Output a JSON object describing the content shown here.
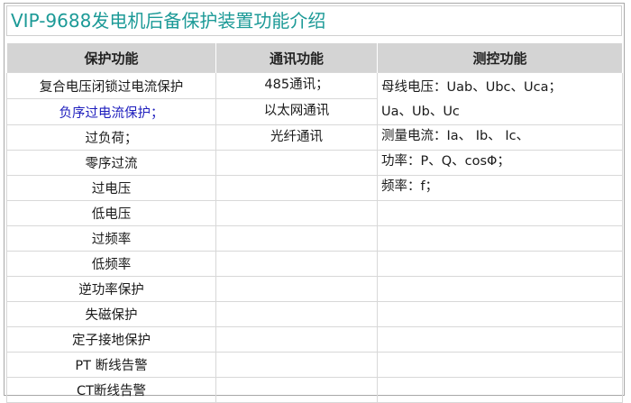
{
  "title": "VIP-9688发电机后备保护装置功能介绍",
  "headers": {
    "protection": "保护功能",
    "communication": "通讯功能",
    "measurement": "测控功能"
  },
  "protection_items": [
    "复合电压闭锁过电流保护",
    "负序过电流保护；",
    "过负荷；",
    "零序过流",
    "过电压",
    "低电压",
    "过频率",
    "低频率",
    "逆功率保护",
    "失磁保护",
    "定子接地保护",
    "PT 断线告警",
    "CT断线告警"
  ],
  "communication_items": [
    "485通讯；",
    "以太网通讯",
    "光纤通讯"
  ],
  "measurement": {
    "voltage_line1": "母线电压：Uab、Ubc、Uca；",
    "voltage_line2": "Ua、Ub、Uc",
    "current": "测量电流：Ia、 Ib、 Ic、",
    "power": "功率：P、Q、cosΦ；",
    "frequency": "频率：f；"
  }
}
